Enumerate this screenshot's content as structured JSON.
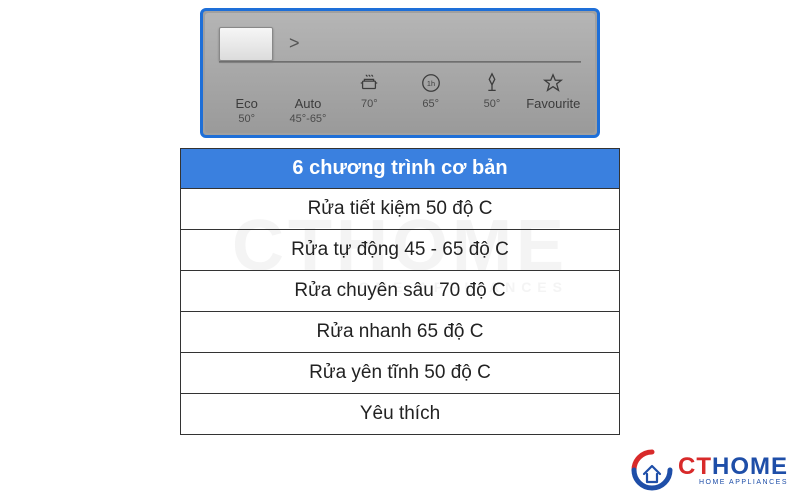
{
  "watermark": {
    "main": "CTHOME",
    "sub": "HOME APPLIANCES"
  },
  "panel": {
    "slider_pointer": ">",
    "programs": [
      {
        "label": "Eco",
        "temp": "50°",
        "icon": "none"
      },
      {
        "label": "Auto",
        "temp": "45°-65°",
        "icon": "none"
      },
      {
        "label": "",
        "temp": "70°",
        "icon": "pot"
      },
      {
        "label": "",
        "temp": "65°",
        "icon": "clock1h"
      },
      {
        "label": "",
        "temp": "50°",
        "icon": "silence"
      },
      {
        "label": "Favourite",
        "temp": "",
        "icon": "star"
      }
    ]
  },
  "table": {
    "header": "6 chương trình cơ bản",
    "rows": [
      "Rửa tiết kiệm 50 độ C",
      "Rửa tự động 45 - 65 độ C",
      "Rửa chuyên sâu 70 độ C",
      "Rửa nhanh 65 độ C",
      "Rửa yên tĩnh 50 độ C",
      "Yêu thích"
    ]
  },
  "logo": {
    "ct": "CT",
    "home": "HOME",
    "sub": "HOME APPLIANCES"
  }
}
